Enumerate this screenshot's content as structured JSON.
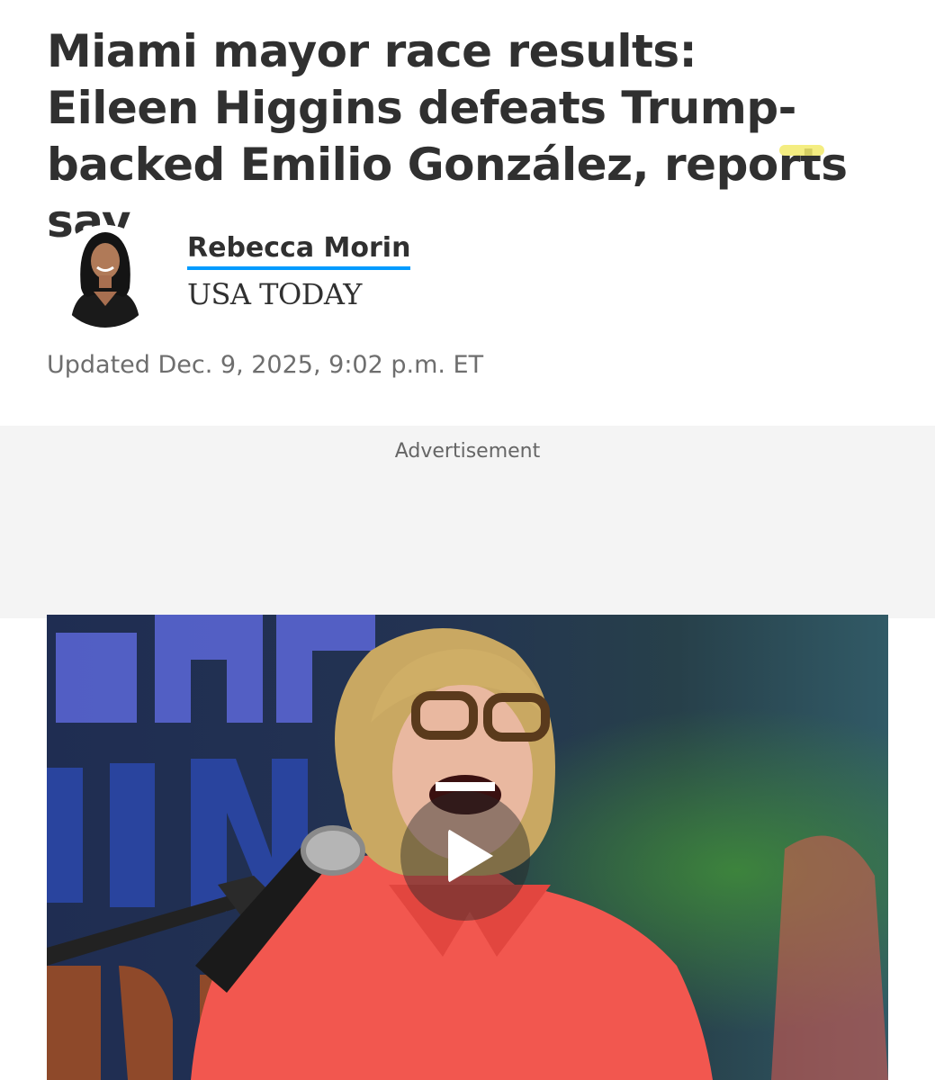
{
  "article": {
    "headline": "Miami mayor race results: Eileen Higgins defeats Trump-backed Emilio González, reports say",
    "author": {
      "name": "Rebecca Morin",
      "outlet": "USA TODAY"
    },
    "timestamp": "Updated Dec. 9, 2025, 9:02 p.m. ET"
  },
  "ad": {
    "label": "Advertisement"
  },
  "video": {
    "play_icon": "play-icon"
  },
  "colors": {
    "text": "#303030",
    "muted": "#6e6e6e",
    "author_underline": "#009bff",
    "ad_background": "#f4f4f4",
    "highlight": "#f2ea6b"
  }
}
